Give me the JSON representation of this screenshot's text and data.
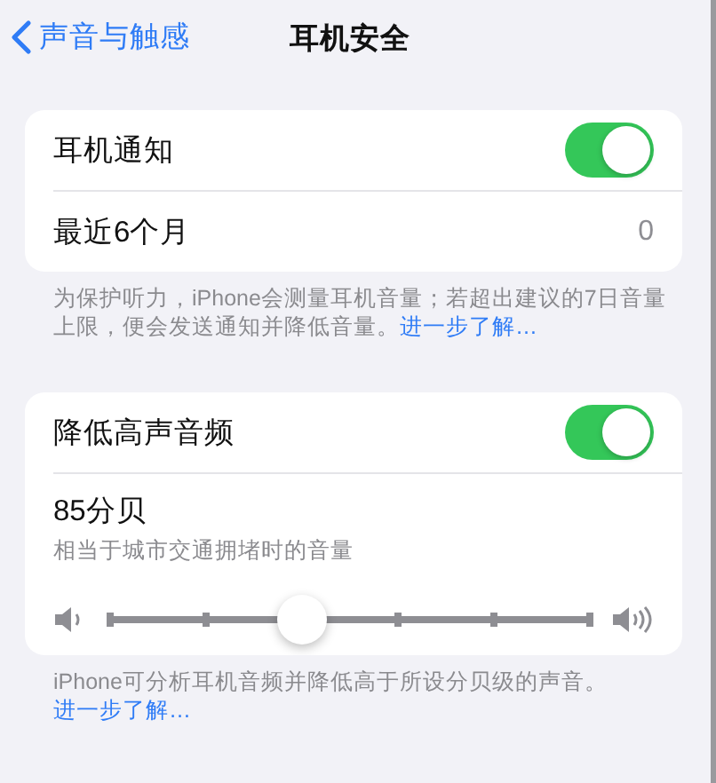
{
  "nav": {
    "back": "声音与触感",
    "title": "耳机安全"
  },
  "groups": [
    {
      "rows": [
        {
          "kind": "toggle",
          "label": "耳机通知",
          "on": true
        },
        {
          "kind": "value",
          "label": "最近6个月",
          "value": "0"
        }
      ],
      "footer": {
        "text": "为保护听力，iPhone会测量耳机音量；若超出建议的7日音量上限，便会发送通知并降低音量。",
        "link": "进一步了解…"
      }
    },
    {
      "rows": [
        {
          "kind": "toggle",
          "label": "降低高声音频",
          "on": true
        },
        {
          "kind": "slider",
          "label": "85分贝",
          "sublabel": "相当于城市交通拥堵时的音量",
          "level": 0.4
        }
      ],
      "footer": {
        "text": "iPhone可分析耳机音频并降低高于所设分贝级的声音。",
        "link": "进一步了解…"
      }
    }
  ]
}
